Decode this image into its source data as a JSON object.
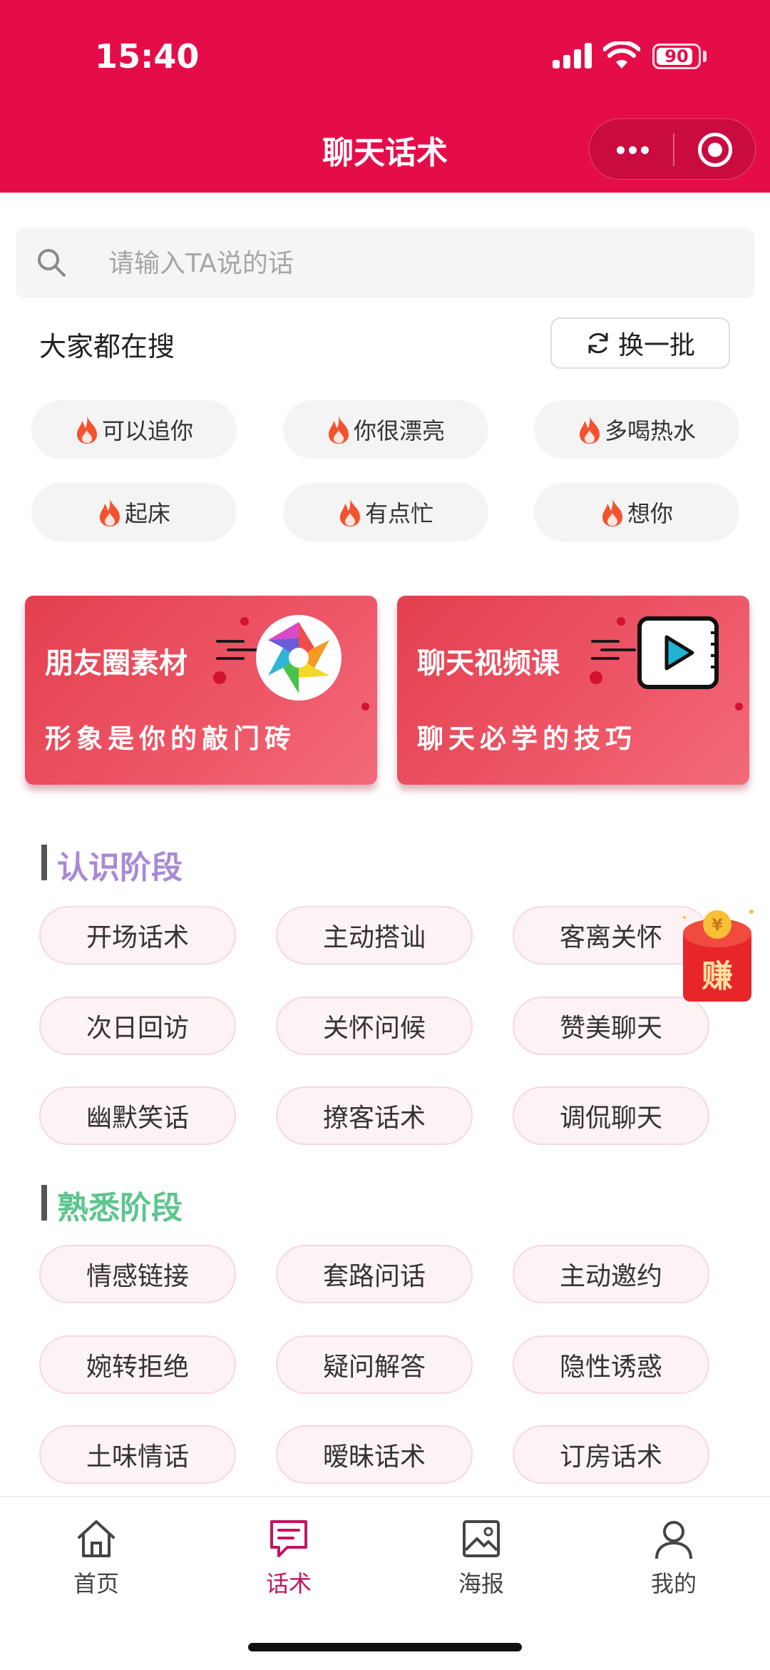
{
  "status_bar": {
    "time": "15:40",
    "battery": "90",
    "battery_level": 0.9
  },
  "header": {
    "title": "聊天话术"
  },
  "search": {
    "placeholder": "请输入TA说的话"
  },
  "hot": {
    "title": "大家都在搜",
    "refresh_label": "换一批",
    "tags": [
      "可以追你",
      "你很漂亮",
      "多喝热水",
      "起床",
      "有点忙",
      "想你"
    ]
  },
  "banners": [
    {
      "title": "朋友圈素材",
      "subtitle": "形象是你的敲门砖"
    },
    {
      "title": "聊天视频课",
      "subtitle": "聊天必学的技巧"
    }
  ],
  "sections": [
    {
      "title": "认识阶段",
      "title_color": "#A889D8",
      "items": [
        "开场话术",
        "主动搭讪",
        "客离关怀",
        "次日回访",
        "关怀问候",
        "赞美聊天",
        "幽默笑话",
        "撩客话术",
        "调侃聊天"
      ]
    },
    {
      "title": "熟悉阶段",
      "title_color": "#5CC58F",
      "items": [
        "情感链接",
        "套路问话",
        "主动邀约",
        "婉转拒绝",
        "疑问解答",
        "隐性诱惑",
        "土味情话",
        "暧昧话术",
        "订房话术"
      ]
    }
  ],
  "float_badge": {
    "label": "赚"
  },
  "tabbar": {
    "items": [
      {
        "label": "首页",
        "icon": "home-icon"
      },
      {
        "label": "话术",
        "icon": "chat-icon"
      },
      {
        "label": "海报",
        "icon": "image-icon"
      },
      {
        "label": "我的",
        "icon": "user-icon"
      }
    ],
    "active": "话术"
  },
  "colors": {
    "brand": "#E50D49",
    "tab_active": "#C3155E"
  }
}
